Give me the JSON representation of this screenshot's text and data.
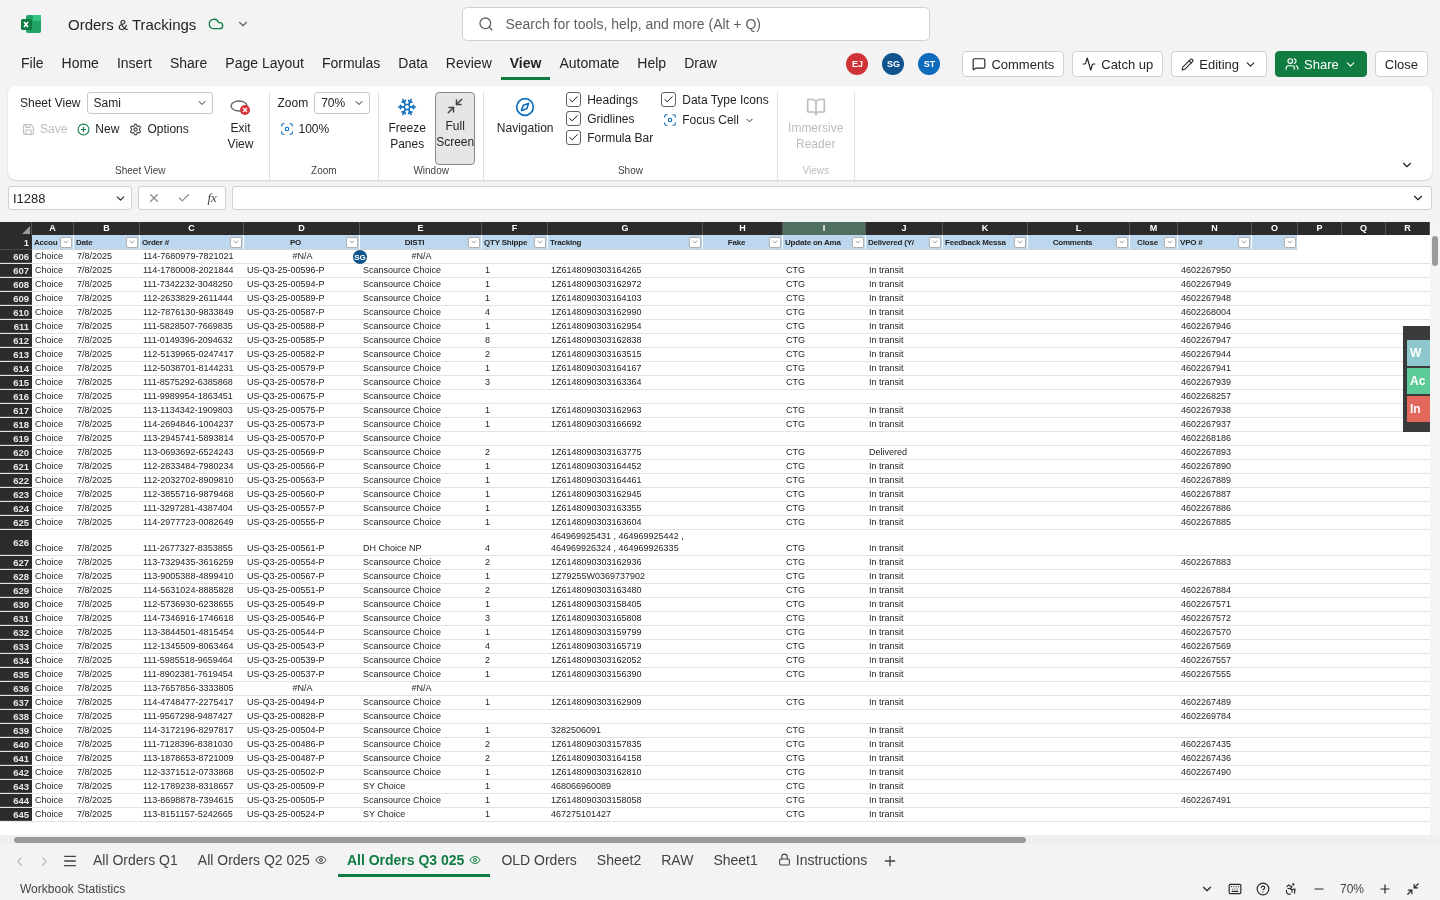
{
  "title_bar": {
    "document": "Orders & Trackings",
    "search": {
      "placeholder": "Search for tools, help, and more (Alt + Q)"
    }
  },
  "menu": [
    {
      "label": "File",
      "selected": false
    },
    {
      "label": "Home",
      "selected": false
    },
    {
      "label": "Insert",
      "selected": false
    },
    {
      "label": "Share",
      "selected": false
    },
    {
      "label": "Page Layout",
      "selected": false
    },
    {
      "label": "Formulas",
      "selected": false
    },
    {
      "label": "Data",
      "selected": false
    },
    {
      "label": "Review",
      "selected": false
    },
    {
      "label": "View",
      "selected": true
    },
    {
      "label": "Automate",
      "selected": false
    },
    {
      "label": "Help",
      "selected": false
    },
    {
      "label": "Draw",
      "selected": false
    }
  ],
  "collaborators": [
    {
      "initials": "EJ",
      "color": "#d13438"
    },
    {
      "initials": "SG",
      "color": "#0f548c"
    },
    {
      "initials": "ST",
      "color": "#0f6cbd"
    }
  ],
  "actions": [
    {
      "kind": "comments",
      "label": "Comments"
    },
    {
      "kind": "catchup",
      "label": "Catch up"
    },
    {
      "kind": "editing",
      "label": "Editing"
    },
    {
      "kind": "share",
      "label": "Share"
    },
    {
      "kind": "close",
      "label": "Close"
    }
  ],
  "ribbon": {
    "sheet_view": {
      "label": "Sheet View",
      "field_label": "Sheet View",
      "field_value": "Sami",
      "actions": [
        {
          "kind": "save",
          "label": "Save",
          "disabled": true
        },
        {
          "kind": "new",
          "label": "New",
          "disabled": false
        },
        {
          "kind": "options",
          "label": "Options",
          "disabled": false
        }
      ],
      "exit": "Exit View"
    },
    "zoom": {
      "label": "Zoom",
      "field_label": "Zoom",
      "field_value": "70%",
      "reset": "100%"
    },
    "window": {
      "label": "Window",
      "buttons": [
        {
          "kind": "freeze",
          "label": "Freeze Panes",
          "selected": false
        },
        {
          "kind": "fullscreen",
          "label": "Full Screen",
          "selected": true
        }
      ]
    },
    "show": {
      "label": "Show",
      "navigation": "Navigation",
      "checks": [
        {
          "label": "Headings",
          "checked": true
        },
        {
          "label": "Gridlines",
          "checked": true
        },
        {
          "label": "Formula Bar",
          "checked": true
        },
        {
          "label": "Data Type Icons",
          "checked": true
        }
      ],
      "focus_cell": "Focus Cell"
    },
    "views": {
      "label": "Views",
      "button": {
        "label": "Immersive Reader",
        "disabled": true
      }
    }
  },
  "formula_bar": {
    "name_box": "I1288",
    "function_label": "fx"
  },
  "sheet": {
    "columns": [
      {
        "letter": "A",
        "header": "Accou",
        "filter": true,
        "selected": false
      },
      {
        "letter": "B",
        "header": "Date",
        "filter": true,
        "selected": false
      },
      {
        "letter": "C",
        "header": "Order #",
        "filter": true,
        "selected": false
      },
      {
        "letter": "D",
        "header": "PO",
        "filter": true,
        "selected": false,
        "center": true
      },
      {
        "letter": "E",
        "header": "DISTI",
        "filter": true,
        "selected": false,
        "center": true
      },
      {
        "letter": "F",
        "header": "QTY Shippe",
        "filter": true,
        "selected": false
      },
      {
        "letter": "G",
        "header": "Tracking",
        "filter": true,
        "selected": false
      },
      {
        "letter": "H",
        "header": "Fake",
        "filter": true,
        "selected": false,
        "center": true
      },
      {
        "letter": "I",
        "header": "Update on Ama",
        "filter": true,
        "selected": true
      },
      {
        "letter": "J",
        "header": "Delivered (Y/",
        "filter": true,
        "selected": false
      },
      {
        "letter": "K",
        "header": "Feedback Messa",
        "filter": true,
        "selected": false
      },
      {
        "letter": "L",
        "header": "Comments",
        "filter": true,
        "selected": false,
        "center": true
      },
      {
        "letter": "M",
        "header": "Close",
        "filter": true,
        "selected": false,
        "center": true
      },
      {
        "letter": "N",
        "header": "VPO #",
        "filter": true,
        "selected": false
      },
      {
        "letter": "O",
        "filter": true,
        "selected": false
      },
      {
        "letter": "P",
        "filter": false,
        "selected": false
      },
      {
        "letter": "Q",
        "filter": false,
        "selected": false
      },
      {
        "letter": "R",
        "filter": false,
        "selected": false
      }
    ],
    "header_row": "1",
    "rows": [
      {
        "num": "606",
        "cells": {
          "A": "Choice",
          "B": "7/8/2025",
          "C": "114-7680979-7821021",
          "D": {
            "text": "#N/A",
            "kind": "error"
          },
          "E": {
            "text": "#N/A",
            "kind": "error",
            "presence": "SG"
          }
        }
      },
      {
        "num": "607",
        "cells": {
          "A": "Choice",
          "B": "7/8/2025",
          "C": "114-1780008-2021844",
          "D": "US-Q3-25-00596-P",
          "E": "Scansource Choice",
          "F": "1",
          "G": "1Z6148090303164265",
          "I": "CTG",
          "J": "In transit",
          "N": "4602267950"
        }
      },
      {
        "num": "608",
        "cells": {
          "A": "Choice",
          "B": "7/8/2025",
          "C": "111-7342232-3048250",
          "D": "US-Q3-25-00594-P",
          "E": "Scansource Choice",
          "F": "1",
          "G": "1Z6148090303162972",
          "I": "CTG",
          "J": "In transit",
          "N": "4602267949"
        }
      },
      {
        "num": "609",
        "cells": {
          "A": "Choice",
          "B": "7/8/2025",
          "C": "112-2633829-2611444",
          "D": "US-Q3-25-00589-P",
          "E": "Scansource Choice",
          "F": "1",
          "G": "1Z6148090303164103",
          "I": "CTG",
          "J": "In transit",
          "N": "4602267948"
        }
      },
      {
        "num": "610",
        "cells": {
          "A": "Choice",
          "B": "7/8/2025",
          "C": "112-7876130-9833849",
          "D": "US-Q3-25-00587-P",
          "E": "Scansource Choice",
          "F": "4",
          "G": "1Z6148090303162990",
          "I": "CTG",
          "J": "In transit",
          "N": "4602268004"
        }
      },
      {
        "num": "611",
        "cells": {
          "A": "Choice",
          "B": "7/8/2025",
          "C": "111-5828507-7669835",
          "D": "US-Q3-25-00588-P",
          "E": "Scansource Choice",
          "F": "1",
          "G": "1Z6148090303162954",
          "I": "CTG",
          "J": "In transit",
          "N": "4602267946"
        }
      },
      {
        "num": "612",
        "cells": {
          "A": "Choice",
          "B": "7/8/2025",
          "C": "111-0149396-2094632",
          "D": "US-Q3-25-00585-P",
          "E": "Scansource Choice",
          "F": "8",
          "G": "1Z6148090303162838",
          "I": "CTG",
          "J": "In transit",
          "N": "4602267947"
        }
      },
      {
        "num": "613",
        "cells": {
          "A": "Choice",
          "B": "7/8/2025",
          "C": "112-5139965-0247417",
          "D": "US-Q3-25-00582-P",
          "E": "Scansource Choice",
          "F": "2",
          "G": "1Z6148090303163515",
          "I": "CTG",
          "J": "In transit",
          "N": "4602267944"
        }
      },
      {
        "num": "614",
        "cells": {
          "A": "Choice",
          "B": "7/8/2025",
          "C": "112-5038701-8144231",
          "D": "US-Q3-25-00579-P",
          "E": "Scansource Choice",
          "F": "1",
          "G": "1Z6148090303164167",
          "I": "CTG",
          "J": "In transit",
          "N": "4602267941"
        }
      },
      {
        "num": "615",
        "cells": {
          "A": "Choice",
          "B": "7/8/2025",
          "C": "111-8575292-6385868",
          "D": "US-Q3-25-00578-P",
          "E": "Scansource Choice",
          "F": "3",
          "G": "1Z6148090303163364",
          "I": "CTG",
          "J": "In transit",
          "N": "4602267939"
        }
      },
      {
        "num": "616",
        "cells": {
          "A": "Choice",
          "B": "7/8/2025",
          "C": "111-9989954-1863451",
          "D": "US-Q3-25-00675-P",
          "E": "Scansource Choice",
          "N": "4602268257"
        }
      },
      {
        "num": "617",
        "cells": {
          "A": "Choice",
          "B": "7/8/2025",
          "C": "113-1134342-1909803",
          "D": "US-Q3-25-00575-P",
          "E": "Scansource Choice",
          "F": "1",
          "G": "1Z6148090303162963",
          "I": "CTG",
          "J": "In transit",
          "N": "4602267938"
        }
      },
      {
        "num": "618",
        "cells": {
          "A": "Choice",
          "B": "7/8/2025",
          "C": "114-2694846-1004237",
          "D": "US-Q3-25-00573-P",
          "E": "Scansource Choice",
          "F": "1",
          "G": "1Z6148090303166692",
          "I": "CTG",
          "J": "In transit",
          "N": "4602267937"
        }
      },
      {
        "num": "619",
        "cells": {
          "A": "Choice",
          "B": "7/8/2025",
          "C": "113-2945741-5893814",
          "D": "US-Q3-25-00570-P",
          "E": "Scansource Choice",
          "N": "4602268186"
        }
      },
      {
        "num": "620",
        "cells": {
          "A": "Choice",
          "B": "7/8/2025",
          "C": "113-0693692-6524243",
          "D": "US-Q3-25-00569-P",
          "E": "Scansource Choice",
          "F": "2",
          "G": "1Z6148090303163775",
          "I": "CTG",
          "J": "Delivered",
          "N": "4602267893"
        }
      },
      {
        "num": "621",
        "cells": {
          "A": "Choice",
          "B": "7/8/2025",
          "C": "112-2833484-7980234",
          "D": "US-Q3-25-00566-P",
          "E": "Scansource Choice",
          "F": "1",
          "G": "1Z6148090303164452",
          "I": "CTG",
          "J": "In transit",
          "N": "4602267890"
        }
      },
      {
        "num": "622",
        "cells": {
          "A": "Choice",
          "B": "7/8/2025",
          "C": "112-2032702-8909810",
          "D": "US-Q3-25-00563-P",
          "E": "Scansource Choice",
          "F": "1",
          "G": "1Z6148090303164461",
          "I": "CTG",
          "J": "In transit",
          "N": "4602267889"
        }
      },
      {
        "num": "623",
        "cells": {
          "A": "Choice",
          "B": "7/8/2025",
          "C": "112-3855716-9879468",
          "D": "US-Q3-25-00560-P",
          "E": "Scansource Choice",
          "F": "1",
          "G": "1Z6148090303162945",
          "I": "CTG",
          "J": "In transit",
          "N": "4602267887"
        }
      },
      {
        "num": "624",
        "cells": {
          "A": "Choice",
          "B": "7/8/2025",
          "C": "111-3297281-4387404",
          "D": "US-Q3-25-00557-P",
          "E": "Scansource Choice",
          "F": "1",
          "G": "1Z6148090303163355",
          "I": "CTG",
          "J": "In transit",
          "N": "4602267886"
        }
      },
      {
        "num": "625",
        "cells": {
          "A": "Choice",
          "B": "7/8/2025",
          "C": "114-2977723-0082649",
          "D": "US-Q3-25-00555-P",
          "E": "Scansource Choice",
          "F": "1",
          "G": "1Z6148090303163604",
          "I": "CTG",
          "J": "In transit",
          "N": "4602267885"
        }
      },
      {
        "num": "626",
        "cells": {
          "A": "Choice",
          "B": "7/8/2025",
          "C": "111-2677327-8353855",
          "D": "US-Q3-25-00561-P",
          "E": "DH Choice NP",
          "F": "4",
          "G": "464969925431 , 464969925442 , 464969926324 , 464969926335",
          "I": "CTG",
          "J": "In transit"
        }
      },
      {
        "num": "627",
        "cells": {
          "A": "Choice",
          "B": "7/8/2025",
          "C": "113-7329435-3616259",
          "D": "US-Q3-25-00554-P",
          "E": "Scansource Choice",
          "F": "2",
          "G": "1Z6148090303162936",
          "I": "CTG",
          "J": "In transit",
          "N": "4602267883"
        }
      },
      {
        "num": "628",
        "cells": {
          "A": "Choice",
          "B": "7/8/2025",
          "C": "113-9005388-4899410",
          "D": "US-Q3-25-00567-P",
          "E": "Scansource Choice",
          "F": "1",
          "G": "1Z79255W0369737902",
          "I": "CTG",
          "J": "In transit"
        }
      },
      {
        "num": "629",
        "cells": {
          "A": "Choice",
          "B": "7/8/2025",
          "C": "114-5631024-8885828",
          "D": "US-Q3-25-00551-P",
          "E": "Scansource Choice",
          "F": "2",
          "G": "1Z6148090303163480",
          "I": "CTG",
          "J": "In transit",
          "N": "4602267884"
        }
      },
      {
        "num": "630",
        "cells": {
          "A": "Choice",
          "B": "7/8/2025",
          "C": "112-5736930-6238655",
          "D": "US-Q3-25-00549-P",
          "E": "Scansource Choice",
          "F": "1",
          "G": "1Z6148090303158405",
          "I": "CTG",
          "J": "In transit",
          "N": "4602267571"
        }
      },
      {
        "num": "631",
        "cells": {
          "A": "Choice",
          "B": "7/8/2025",
          "C": "114-7346916-1746618",
          "D": "US-Q3-25-00546-P",
          "E": "Scansource Choice",
          "F": "3",
          "G": "1Z6148090303165808",
          "I": "CTG",
          "J": "In transit",
          "N": "4602267572"
        }
      },
      {
        "num": "632",
        "cells": {
          "A": "Choice",
          "B": "7/8/2025",
          "C": "113-3844501-4815454",
          "D": "US-Q3-25-00544-P",
          "E": "Scansource Choice",
          "F": "1",
          "G": "1Z6148090303159799",
          "I": "CTG",
          "J": "In transit",
          "N": "4602267570"
        }
      },
      {
        "num": "633",
        "cells": {
          "A": "Choice",
          "B": "7/8/2025",
          "C": "112-1345509-8063464",
          "D": "US-Q3-25-00543-P",
          "E": "Scansource Choice",
          "F": "4",
          "G": "1Z6148090303165719",
          "I": "CTG",
          "J": "In transit",
          "N": "4602267569"
        }
      },
      {
        "num": "634",
        "cells": {
          "A": "Choice",
          "B": "7/8/2025",
          "C": "111-5985518-9659464",
          "D": "US-Q3-25-00539-P",
          "E": "Scansource Choice",
          "F": "2",
          "G": "1Z6148090303162052",
          "I": "CTG",
          "J": "In transit",
          "N": "4602267557"
        }
      },
      {
        "num": "635",
        "cells": {
          "A": "Choice",
          "B": "7/8/2025",
          "C": "111-8902381-7619454",
          "D": "US-Q3-25-00537-P",
          "E": "Scansource Choice",
          "F": "1",
          "G": "1Z6148090303156390",
          "I": "CTG",
          "J": "In transit",
          "N": "4602267555"
        }
      },
      {
        "num": "636",
        "cells": {
          "A": "Choice",
          "B": "7/8/2025",
          "C": "113-7657856-3333805",
          "D": {
            "text": "#N/A",
            "kind": "error"
          },
          "E": {
            "text": "#N/A",
            "kind": "error"
          }
        }
      },
      {
        "num": "637",
        "cells": {
          "A": "Choice",
          "B": "7/8/2025",
          "C": "114-4748477-2275417",
          "D": "US-Q3-25-00494-P",
          "E": "Scansource Choice",
          "F": "1",
          "G": "1Z6148090303162909",
          "I": "CTG",
          "J": "In transit",
          "N": "4602267489"
        }
      },
      {
        "num": "638",
        "cells": {
          "A": "Choice",
          "B": "7/8/2025",
          "C": "111-9567298-9487427",
          "D": "US-Q3-25-00828-P",
          "E": "Scansource Choice",
          "N": "4602269784"
        }
      },
      {
        "num": "639",
        "cells": {
          "A": "Choice",
          "B": "7/8/2025",
          "C": "114-3172196-8297817",
          "D": "US-Q3-25-00504-P",
          "E": "Scansource Choice",
          "F": "1",
          "G": "3282506091",
          "I": "CTG",
          "J": "In transit"
        }
      },
      {
        "num": "640",
        "cells": {
          "A": "Choice",
          "B": "7/8/2025",
          "C": "111-7128396-8381030",
          "D": "US-Q3-25-00486-P",
          "E": "Scansource Choice",
          "F": "2",
          "G": "1Z6148090303157835",
          "I": "CTG",
          "J": "In transit",
          "N": "4602267435"
        }
      },
      {
        "num": "641",
        "cells": {
          "A": "Choice",
          "B": "7/8/2025",
          "C": "113-1878653-8721009",
          "D": "US-Q3-25-00487-P",
          "E": "Scansource Choice",
          "F": "2",
          "G": "1Z6148090303164158",
          "I": "CTG",
          "J": "In transit",
          "N": "4602267436"
        }
      },
      {
        "num": "642",
        "cells": {
          "A": "Choice",
          "B": "7/8/2025",
          "C": "112-3371512-0733868",
          "D": "US-Q3-25-00502-P",
          "E": "Scansource Choice",
          "F": "1",
          "G": "1Z6148090303162810",
          "I": "CTG",
          "J": "In transit",
          "N": "4602267490"
        }
      },
      {
        "num": "643",
        "cells": {
          "A": "Choice",
          "B": "7/8/2025",
          "C": "112-1789238-8318657",
          "D": "US-Q3-25-00509-P",
          "E": "SY Choice",
          "F": "1",
          "G": "468066960089",
          "I": "CTG",
          "J": "In transit"
        }
      },
      {
        "num": "644",
        "cells": {
          "A": "Choice",
          "B": "7/8/2025",
          "C": "113-8698878-7394615",
          "D": "US-Q3-25-00505-P",
          "E": "Scansource Choice",
          "F": "1",
          "G": "1Z6148090303158058",
          "I": "CTG",
          "J": "In transit",
          "N": "4602267491"
        }
      },
      {
        "num": "645",
        "cells": {
          "A": "Choice",
          "B": "7/8/2025",
          "C": "113-8151157-5242665",
          "D": "US-Q3-25-00524-P",
          "E": "SY Choice",
          "F": "1",
          "G": "467275101427",
          "I": "CTG",
          "J": "In transit"
        }
      }
    ]
  },
  "side_panel": [
    {
      "label": "W",
      "color": "#8cc8cc"
    },
    {
      "label": "Ac",
      "color": "#5ccb98"
    },
    {
      "label": "In",
      "color": "#e2685c"
    }
  ],
  "sheet_tabs": [
    {
      "label": "All Orders Q1",
      "selected": false,
      "shared": false,
      "locked": false
    },
    {
      "label": "All Orders Q2 025",
      "selected": false,
      "shared": true,
      "locked": false
    },
    {
      "label": "All Orders Q3 025",
      "selected": true,
      "shared": true,
      "locked": false
    },
    {
      "label": "OLD Orders",
      "selected": false,
      "shared": false,
      "locked": false
    },
    {
      "label": "Sheet2",
      "selected": false,
      "shared": false,
      "locked": false
    },
    {
      "label": "RAW",
      "selected": false,
      "shared": false,
      "locked": false
    },
    {
      "label": "Sheet1",
      "selected": false,
      "shared": false,
      "locked": false
    },
    {
      "label": "Instructions",
      "selected": false,
      "shared": false,
      "locked": true
    }
  ],
  "status_bar": {
    "left": "Workbook Statistics",
    "zoom": "70%"
  }
}
